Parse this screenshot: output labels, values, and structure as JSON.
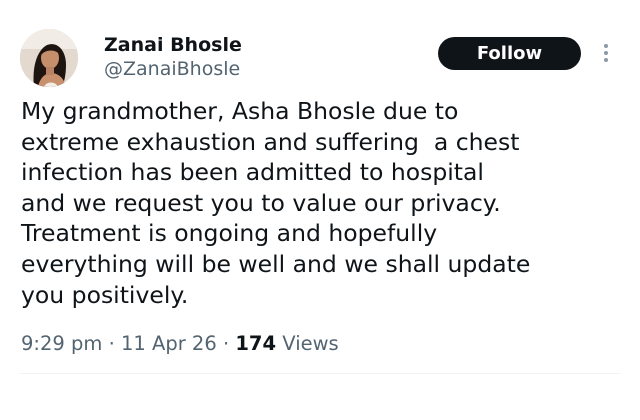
{
  "author": {
    "display_name": "Zanai Bhosle",
    "handle": "@ZanaiBhosle"
  },
  "actions": {
    "follow_label": "Follow",
    "more_icon": "more-vertical-icon"
  },
  "tweet": {
    "lines": [
      "My grandmother, Asha Bhosle due to",
      "extreme exhaustion and suffering  a chest",
      "infection has been admitted to hospital",
      "and we request you to value our privacy.",
      "Treatment is ongoing and hopefully",
      "everything will be well and we shall update",
      "you positively."
    ]
  },
  "meta": {
    "time": "9:29 pm",
    "separator": "·",
    "date": "11 Apr 26",
    "views_count": "174",
    "views_label": "Views"
  },
  "colors": {
    "text_primary": "#0f1419",
    "text_secondary": "#536471",
    "button_bg": "#0f1419",
    "button_text": "#ffffff",
    "divider": "#eff3f4"
  }
}
